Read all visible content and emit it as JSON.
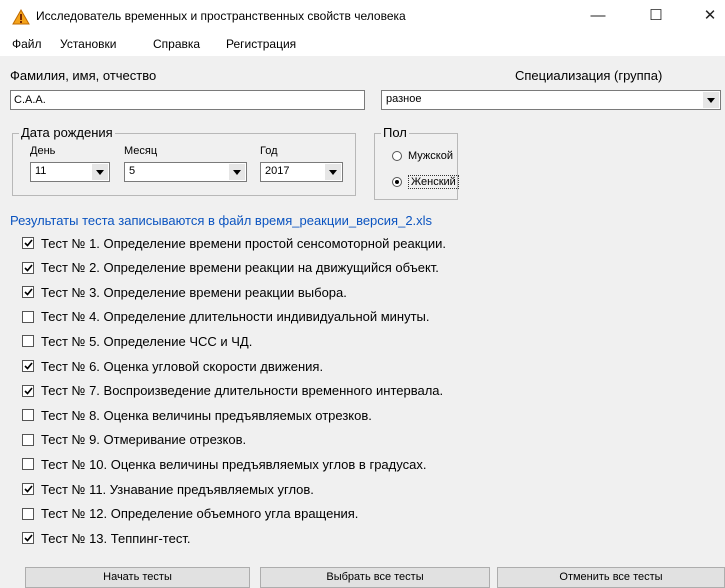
{
  "window": {
    "title": "Исследователь временных и пространственных свойств человека",
    "icon": "triangle-warning-icon",
    "controls": {
      "minimize": "—",
      "maximize": "☐",
      "close": "✕"
    }
  },
  "menu": [
    "Файл",
    "Установки",
    "Справка",
    "Регистрация"
  ],
  "fio": {
    "label": "Фамилия, имя, отчество",
    "value": "С.А.А."
  },
  "specialization": {
    "label": "Специализация (группа)",
    "value": "разное"
  },
  "birth": {
    "legend": "Дата рождения",
    "day_label": "День",
    "day_value": "11",
    "month_label": "Месяц",
    "month_value": "5",
    "year_label": "Год",
    "year_value": "2017"
  },
  "gender": {
    "legend": "Пол",
    "options": [
      {
        "label": "Мужской",
        "selected": false
      },
      {
        "label": "Женский",
        "selected": true
      }
    ]
  },
  "results_note": "Результаты теста записываются в файл время_реакции_версия_2.xls",
  "tests": [
    {
      "label": "Тест № 1. Определение времени простой сенсомоторной реакции.",
      "checked": true
    },
    {
      "label": "Тест № 2. Определение времени реакции на движущийся объект.",
      "checked": true
    },
    {
      "label": "Тест № 3. Определение времени реакции выбора.",
      "checked": true
    },
    {
      "label": "Тест № 4. Определение длительности индивидуальной минуты.",
      "checked": false
    },
    {
      "label": "Тест № 5. Определение ЧСС и ЧД.",
      "checked": false
    },
    {
      "label": "Тест № 6. Оценка угловой скорости движения.",
      "checked": true
    },
    {
      "label": "Тест № 7. Воспроизведение длительности временного интервала.",
      "checked": true
    },
    {
      "label": "Тест № 8. Оценка величины предъявляемых отрезков.",
      "checked": false
    },
    {
      "label": "Тест № 9. Отмеривание отрезков.",
      "checked": false
    },
    {
      "label": "Тест № 10. Оценка величины предъявляемых углов в градусах.",
      "checked": false
    },
    {
      "label": "Тест № 11. Узнавание предъявляемых углов.",
      "checked": true
    },
    {
      "label": "Тест № 12. Определение объемного угла вращения.",
      "checked": false
    },
    {
      "label": "Тест № 13. Теппинг-тест.",
      "checked": true
    }
  ],
  "buttons": {
    "start": "Начать тесты",
    "select_all": "Выбрать все тесты",
    "cancel_all": "Отменить все тесты"
  }
}
